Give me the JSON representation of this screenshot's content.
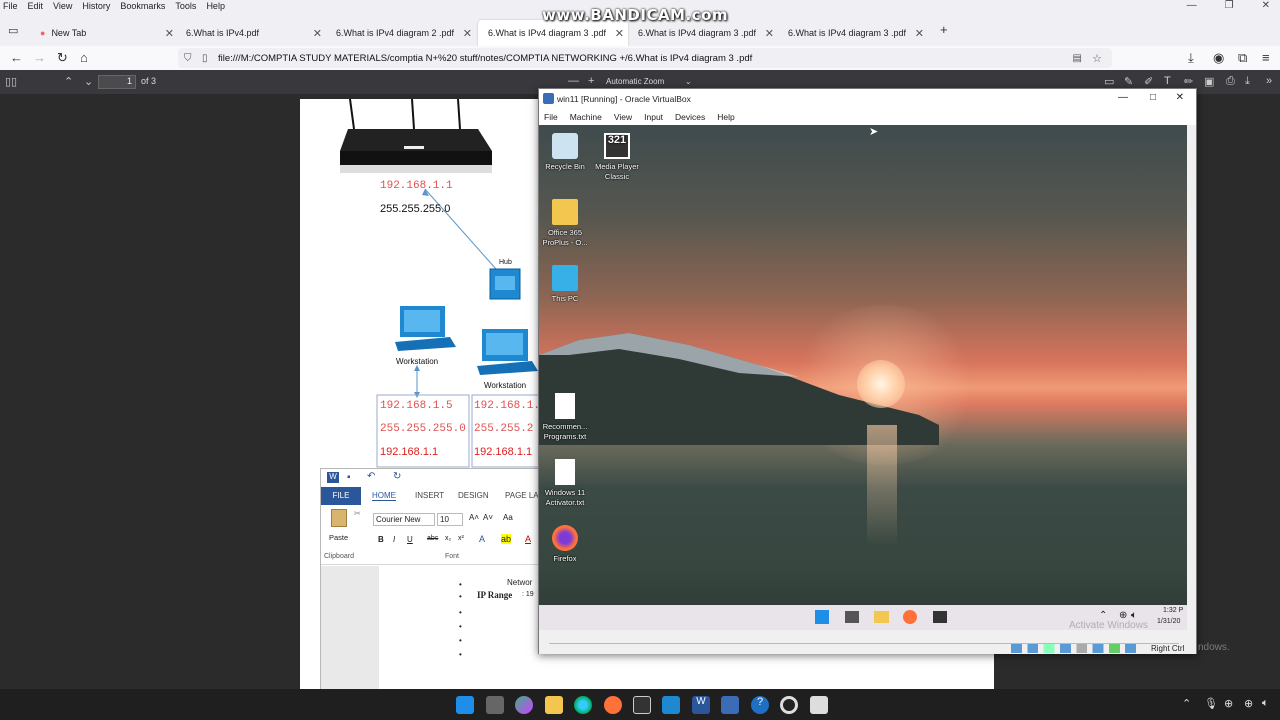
{
  "firefox": {
    "menu": [
      "File",
      "Edit",
      "View",
      "History",
      "Bookmarks",
      "Tools",
      "Help"
    ],
    "tabs": [
      {
        "label": "New Tab"
      },
      {
        "label": "6.What is IPv4.pdf"
      },
      {
        "label": "6.What is IPv4 diagram 2 .pdf"
      },
      {
        "label": "6.What is IPv4 diagram 3 .pdf"
      },
      {
        "label": "6.What is IPv4 diagram 3 .pdf"
      },
      {
        "label": "6.What is IPv4 diagram 3 .pdf"
      }
    ],
    "url": "file:///M:/COMPTIA STUDY MATERIALS/comptia N+%20 stuff/notes/COMPTIA NETWORKING +/6.What is IPv4 diagram 3 .pdf"
  },
  "watermark": "www.BANDICAM.com",
  "pdf_viewer": {
    "page_number": "1",
    "page_total": "of 3",
    "zoom": "Automatic Zoom"
  },
  "diagram": {
    "router_ip": "192.168.1.1",
    "router_mask": "255.255.255.0",
    "hub_label": "Hub",
    "ws1_label": "Workstation",
    "ws2_label": "Workstation",
    "ws1_ip": "192.168.1.5",
    "ws1_mask": "255.255.255.0",
    "ws1_gw": "192.168.1.1",
    "ws2_ip": "192.168.1.1",
    "ws2_mask": "255.255.2",
    "ws2_gw": "192.168.1.1"
  },
  "word": {
    "tabs": [
      "FILE",
      "HOME",
      "INSERT",
      "DESIGN",
      "PAGE LAY"
    ],
    "font_name": "Courier New",
    "font_size": "10",
    "paste": "Paste",
    "clipboard_group": "Clipboard",
    "font_group": "Font",
    "doc_line1": "Networ",
    "doc_line2_bold": "IP Range",
    "doc_line2_rest": ": 19"
  },
  "vbox": {
    "title": "win11 [Running] - Oracle VirtualBox",
    "menu": [
      "File",
      "Machine",
      "View",
      "Input",
      "Devices",
      "Help"
    ],
    "status_text": "Right Ctrl",
    "activate_text": "Activate Windows",
    "desktop_icons": [
      {
        "label": "Recycle Bin",
        "icon": "recycle-bin-icon"
      },
      {
        "label": "Media Player Classic",
        "icon": "media-player-icon"
      },
      {
        "label": "Office 365 ProPlus - O...",
        "icon": "folder-icon"
      },
      {
        "label": "This PC",
        "icon": "monitor-icon"
      },
      {
        "label": "Recommen... Programs.txt",
        "icon": "text-file-icon"
      },
      {
        "label": "Windows 11 Activator.txt",
        "icon": "text-file-icon"
      },
      {
        "label": "Firefox",
        "icon": "firefox-icon"
      }
    ],
    "clock_time": "1:32 P",
    "clock_date": "1/31/20"
  },
  "host_taskbar": {
    "activate_partial": "ndows."
  }
}
